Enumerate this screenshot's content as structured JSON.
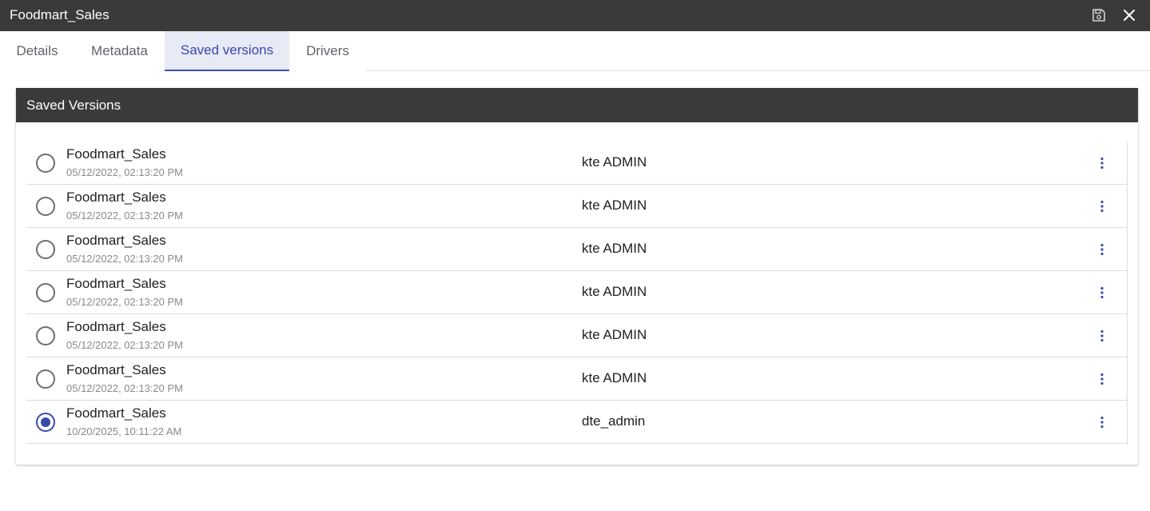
{
  "window": {
    "title": "Foodmart_Sales"
  },
  "tabs": [
    {
      "label": "Details"
    },
    {
      "label": "Metadata"
    },
    {
      "label": "Saved versions",
      "active": true
    },
    {
      "label": "Drivers"
    }
  ],
  "panel": {
    "title": "Saved Versions"
  },
  "versions": [
    {
      "name": "Foodmart_Sales",
      "date": "05/12/2022, 02:13:20 PM",
      "user": "kte ADMIN",
      "selected": false
    },
    {
      "name": "Foodmart_Sales",
      "date": "05/12/2022, 02:13:20 PM",
      "user": "kte ADMIN",
      "selected": false
    },
    {
      "name": "Foodmart_Sales",
      "date": "05/12/2022, 02:13:20 PM",
      "user": "kte ADMIN",
      "selected": false
    },
    {
      "name": "Foodmart_Sales",
      "date": "05/12/2022, 02:13:20 PM",
      "user": "kte ADMIN",
      "selected": false
    },
    {
      "name": "Foodmart_Sales",
      "date": "05/12/2022, 02:13:20 PM",
      "user": "kte ADMIN",
      "selected": false
    },
    {
      "name": "Foodmart_Sales",
      "date": "05/12/2022, 02:13:20 PM",
      "user": "kte ADMIN",
      "selected": false
    },
    {
      "name": "Foodmart_Sales",
      "date": "10/20/2025, 10:11:22 AM",
      "user": "dte_admin",
      "selected": true
    }
  ],
  "icons": {
    "save": "save-icon",
    "close": "close-icon",
    "row_menu": "more-vert-icon"
  },
  "colors": {
    "titlebar_bg": "#3a3a3a",
    "accent": "#3949ab",
    "active_tab_bg": "#e8eaf6"
  }
}
